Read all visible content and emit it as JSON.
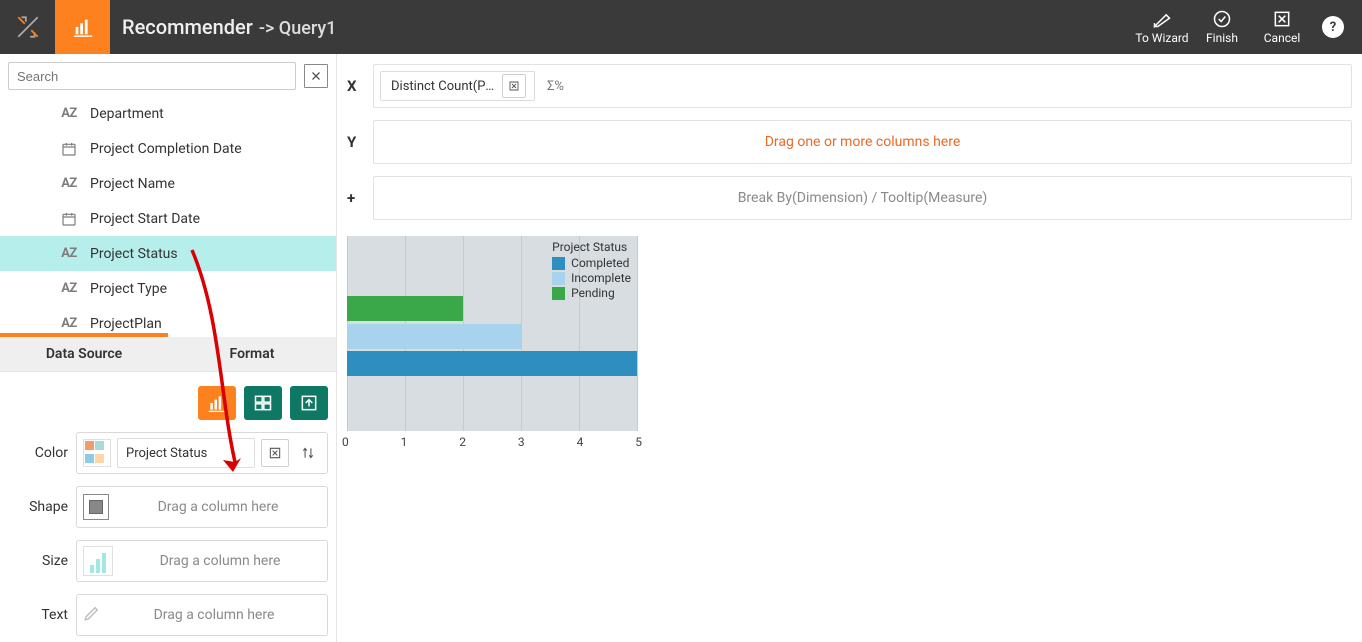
{
  "header": {
    "title": "Recommender",
    "subtitle": "-> Query1",
    "buttons": {
      "wizard": "To Wizard",
      "finish": "Finish",
      "cancel": "Cancel"
    }
  },
  "sidebar": {
    "search_placeholder": "Search",
    "fields": [
      {
        "type": "az",
        "label": "Department"
      },
      {
        "type": "date",
        "label": "Project Completion Date"
      },
      {
        "type": "az",
        "label": "Project Name"
      },
      {
        "type": "date",
        "label": "Project Start Date"
      },
      {
        "type": "az",
        "label": "Project Status",
        "selected": true
      },
      {
        "type": "az",
        "label": "Project Type"
      },
      {
        "type": "az",
        "label": "ProjectPlan"
      }
    ],
    "tabs": {
      "data_source": "Data Source",
      "format": "Format"
    },
    "ds": {
      "color": "Color",
      "shape": "Shape",
      "size": "Size",
      "text": "Text",
      "color_value": "Project Status",
      "drag_placeholder": "Drag a column here"
    }
  },
  "main": {
    "x": "X",
    "y": "Y",
    "plus": "+",
    "x_token": "Distinct Count(Projec...",
    "y_placeholder": "Drag one or more columns here",
    "plus_placeholder": "Break By(Dimension) / Tooltip(Measure)"
  },
  "chart_data": {
    "type": "bar",
    "orientation": "horizontal",
    "title": "Project Status",
    "xlabel": "",
    "ylabel": "",
    "xlim": [
      0,
      5
    ],
    "x_ticks": [
      0,
      1,
      2,
      3,
      4,
      5
    ],
    "series": [
      {
        "name": "Completed",
        "value": 5,
        "color": "#2d8ebf"
      },
      {
        "name": "Incomplete",
        "value": 3,
        "color": "#a8d3ec"
      },
      {
        "name": "Pending",
        "value": 2,
        "color": "#3aa749"
      }
    ],
    "legend_items": [
      {
        "name": "Completed",
        "color": "#2d8ebf"
      },
      {
        "name": "Incomplete",
        "color": "#a8d3ec"
      },
      {
        "name": "Pending",
        "color": "#3aa749"
      }
    ]
  }
}
